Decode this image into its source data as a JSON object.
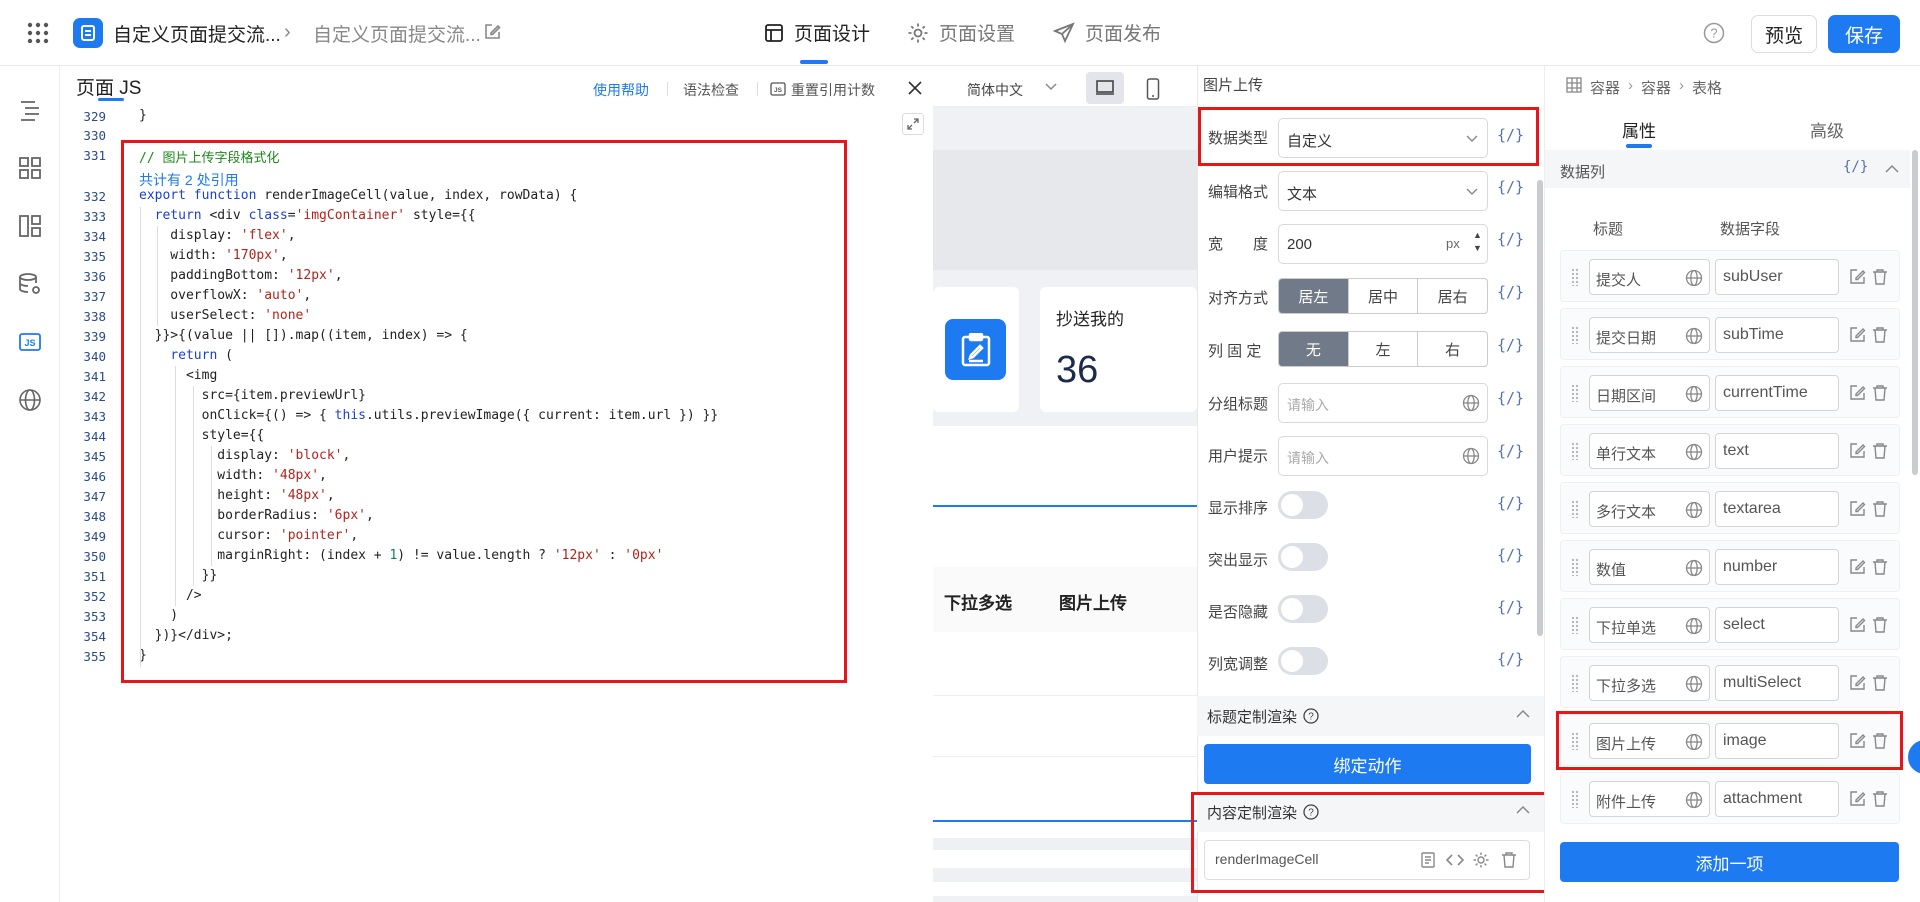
{
  "header": {
    "breadcrumb_app": "自定义页面提交流...",
    "breadcrumb_page": "自定义页面提交流...",
    "tabs": [
      "页面设计",
      "页面设置",
      "页面发布"
    ],
    "preview": "预览",
    "save": "保存"
  },
  "code_panel": {
    "title": "页面 JS",
    "actions": [
      "使用帮助",
      "语法检查",
      "重置引用计数"
    ],
    "ref_count": "共计有 2 处引用",
    "line_numbers": [
      "329",
      "330",
      "331",
      "332",
      "333",
      "334",
      "335",
      "336",
      "337",
      "338",
      "339",
      "340",
      "341",
      "342",
      "343",
      "344",
      "345",
      "346",
      "347",
      "348",
      "349",
      "350",
      "351",
      "352",
      "353",
      "354",
      "355"
    ]
  },
  "canvas": {
    "language": "简体中文",
    "card_title": "抄送我的",
    "card_value": "36",
    "col_multi": "下拉多选",
    "col_image": "图片上传"
  },
  "props": {
    "section_title": "图片上传",
    "data_type": {
      "label": "数据类型",
      "value": "自定义"
    },
    "edit_format": {
      "label": "编辑格式",
      "value": "文本"
    },
    "width": {
      "label": "宽　　度",
      "value": "200",
      "unit": "px"
    },
    "align": {
      "label": "对齐方式",
      "options": [
        "居左",
        "居中",
        "居右"
      ],
      "selected": "居左"
    },
    "fixed": {
      "label": "列 固 定",
      "options": [
        "无",
        "左",
        "右"
      ],
      "selected": "无"
    },
    "group_title": {
      "label": "分组标题",
      "placeholder": "请输入"
    },
    "user_hint": {
      "label": "用户提示",
      "placeholder": "请输入"
    },
    "toggles": [
      {
        "label": "显示排序",
        "on": false
      },
      {
        "label": "突出显示",
        "on": false
      },
      {
        "label": "是否隐藏",
        "on": false
      },
      {
        "label": "列宽调整",
        "on": false
      }
    ],
    "title_render": "标题定制渲染",
    "bind_action": "绑定动作",
    "content_render": "内容定制渲染",
    "content_render_value": "renderImageCell",
    "fx": "{/}"
  },
  "right_panel": {
    "breadcrumb": [
      "容器",
      "容器",
      "表格"
    ],
    "tabs": [
      "属性",
      "高级"
    ],
    "section": "数据列",
    "col_headers": [
      "标题",
      "数据字段"
    ],
    "columns": [
      {
        "title": "提交人",
        "field": "subUser"
      },
      {
        "title": "提交日期",
        "field": "subTime"
      },
      {
        "title": "日期区间",
        "field": "currentTime"
      },
      {
        "title": "单行文本",
        "field": "text"
      },
      {
        "title": "多行文本",
        "field": "textarea"
      },
      {
        "title": "数值",
        "field": "number"
      },
      {
        "title": "下拉单选",
        "field": "select"
      },
      {
        "title": "下拉多选",
        "field": "multiSelect"
      },
      {
        "title": "图片上传",
        "field": "image"
      },
      {
        "title": "附件上传",
        "field": "attachment"
      }
    ],
    "add_item": "添加一项"
  },
  "colors": {
    "accent": "#1e7af0",
    "highlight": "#e8161b"
  }
}
